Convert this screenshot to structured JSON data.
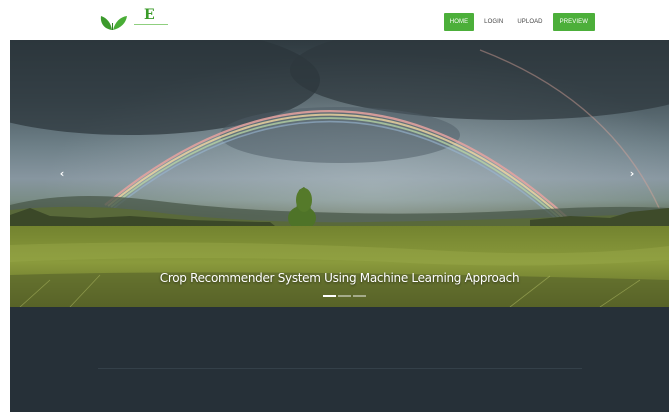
{
  "logo": {
    "letter": "E",
    "icon": "leaf-icon"
  },
  "nav": {
    "items": [
      {
        "label": "HOME",
        "active": true
      },
      {
        "label": "LOGIN",
        "active": false
      },
      {
        "label": "UPLOAD",
        "active": false
      },
      {
        "label": "PREVIEW",
        "active": false
      }
    ]
  },
  "slider": {
    "caption": "Crop Recommender System Using Machine Learning Approach",
    "prev_icon": "chevron-left-icon",
    "next_icon": "chevron-right-icon",
    "prev_glyph": "‹",
    "next_glyph": "›",
    "slide_count": 3,
    "active_slide": 1
  },
  "colors": {
    "accent": "#4caf3a",
    "dark_section": "#263038"
  }
}
